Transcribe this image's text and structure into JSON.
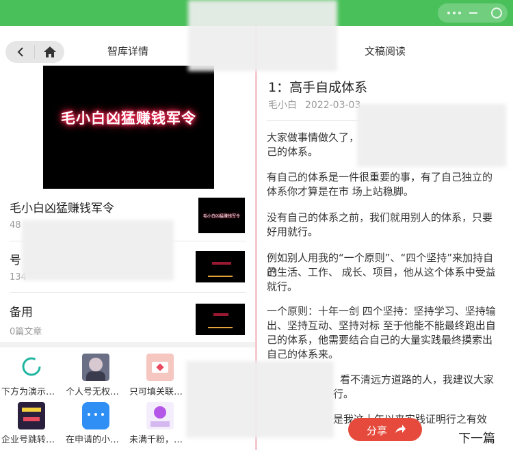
{
  "left": {
    "title": "智库详情",
    "cover_text": "毛小白凶猛赚钱军令",
    "rows": [
      {
        "title": "毛小白凶猛赚钱军令",
        "sub": "48"
      },
      {
        "title": "号",
        "sub": "134"
      },
      {
        "title": "备用",
        "sub": "0篇文章"
      }
    ],
    "grid": [
      {
        "label": "下方为演示…"
      },
      {
        "label": "个人号无权…"
      },
      {
        "label": "只可填关联…"
      },
      {
        "label": "企业号跳转…"
      },
      {
        "label": "在申请的小…"
      },
      {
        "label": "未满千粉，…"
      }
    ],
    "icons": {
      "back": "chevron-left-icon",
      "home": "home-icon"
    }
  },
  "right": {
    "title": "文稿阅读",
    "article_title": "1：高手自成体系",
    "author": "毛小白",
    "date": "2022-03-03",
    "paragraphs": [
      "大家做事情做久了，",
      "己的体系。",
      "有自己的体系是一件很重要的事，有了自己独立的",
      "体系你才算是在市 场上站稳脚。",
      "没有自己的体系之前，我们就用别人的体系，只要",
      "好用就行。",
      "例如别人用我的“一个原则”、“四个坚持”来加持自己",
      "的生活、工作、 成长、项目，他从这个体系中受益",
      "就行。",
      "一个原则：十年一剑 四个坚持：坚持学习、坚持输",
      "出、坚持互动、坚持对标 至于他能不能最终跑出自",
      "己的体系，他需要结合自己的大量实践最终摸索出",
      "自己的体系来。",
      "看不清远方道路的人，我建议大家",
      "行。",
      "是我这十年以来实践证明行之有效"
    ],
    "share_label": "分享",
    "next_label": "下一篇"
  },
  "colors": {
    "topbar": "#4ac05a",
    "share": "#e64a3c",
    "divider": "#f3c8cf"
  }
}
